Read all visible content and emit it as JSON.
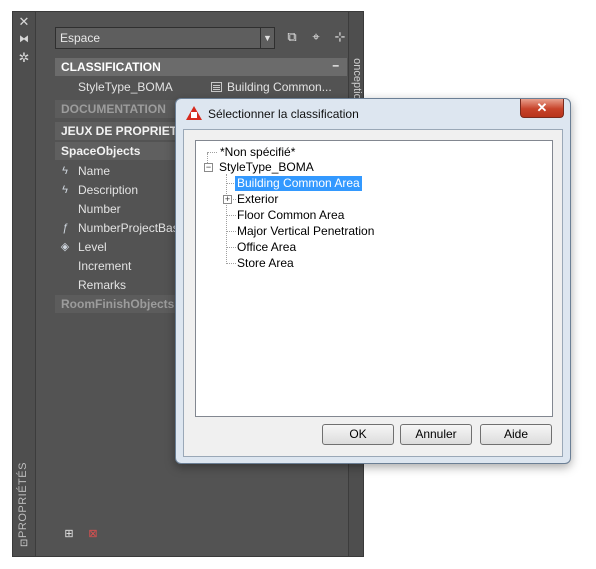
{
  "palette": {
    "dropdown_value": "Espace",
    "vertical_tab": "PROPRIÉTÉS",
    "vertical_tab_right": "onception",
    "sections": {
      "classification": "CLASSIFICATION",
      "documentation": "DOCUMENTATION",
      "property_sets": "JEUX DE PROPRIETES",
      "space_objects": "SpaceObjects",
      "room_finish": "RoomFinishObjects"
    },
    "classification_row": {
      "name": "StyleType_BOMA",
      "value": "Building  Common..."
    },
    "properties": [
      {
        "name": "Name",
        "icon": "lightning-icon"
      },
      {
        "name": "Description",
        "icon": "lightning-icon"
      },
      {
        "name": "Number",
        "icon": ""
      },
      {
        "name": "NumberProjectBased",
        "icon": "formula-icon"
      },
      {
        "name": "Level",
        "icon": "level-icon"
      },
      {
        "name": "Increment",
        "icon": ""
      },
      {
        "name": "Remarks",
        "icon": ""
      }
    ]
  },
  "dialog": {
    "title": "Sélectionner la classification",
    "tree": {
      "unspecified": "*Non spécifié*",
      "root": "StyleType_BOMA",
      "children": [
        "Building Common Area",
        "Exterior",
        "Floor Common Area",
        "Major Vertical Penetration",
        "Office Area",
        "Store Area"
      ],
      "selected": "Building Common Area"
    },
    "buttons": {
      "ok": "OK",
      "cancel": "Annuler",
      "help": "Aide"
    }
  }
}
